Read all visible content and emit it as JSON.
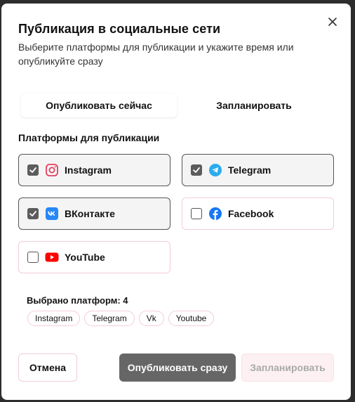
{
  "dialog": {
    "title": "Публикация в социальные сети",
    "description": "Выберите платформы для публикации и укажите время или опубликуйте сразу",
    "close_icon": "close-icon"
  },
  "mode_tabs": {
    "now_label": "Опубликовать сейчас",
    "schedule_label": "Запланировать",
    "active": "now"
  },
  "platforms_section": {
    "label": "Платформы для публикации",
    "items": [
      {
        "label": "Instagram",
        "icon": "instagram-icon",
        "checked": true
      },
      {
        "label": "Telegram",
        "icon": "telegram-icon",
        "checked": true
      },
      {
        "label": "ВКонтакте",
        "icon": "vk-icon",
        "checked": true
      },
      {
        "label": "Facebook",
        "icon": "facebook-icon",
        "checked": false
      },
      {
        "label": "YouTube",
        "icon": "youtube-icon",
        "checked": false
      }
    ]
  },
  "selection": {
    "count_text": "Выбрано платформ: 4",
    "chips": [
      "Instagram",
      "Telegram",
      "Vk",
      "Youtube"
    ]
  },
  "footer": {
    "cancel_label": "Отмена",
    "publish_now_label": "Опубликовать сразу",
    "schedule_label": "Запланировать"
  },
  "colors": {
    "instagram": "#e4405f",
    "telegram": "#2aabee",
    "vk": "#2787f5",
    "facebook": "#1877f2",
    "youtube": "#ff0000",
    "primary_button": "#666666",
    "pink_border": "#f2cdd6"
  }
}
